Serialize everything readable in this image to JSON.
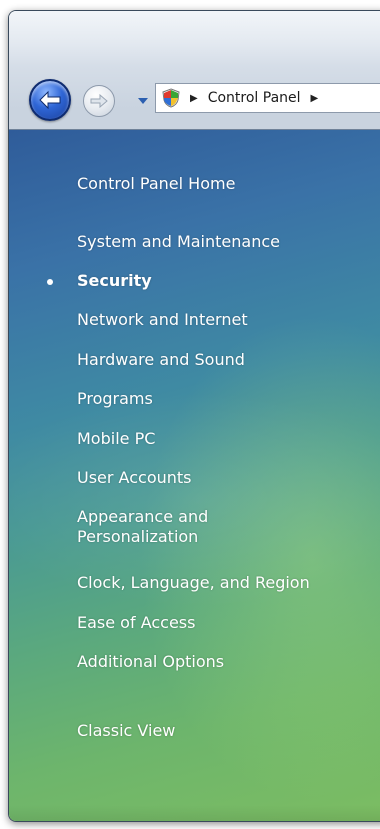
{
  "window": {
    "nav": {
      "back_icon": "back-arrow-icon",
      "forward_icon": "forward-arrow-icon",
      "dropdown_icon": "chevron-down-icon"
    },
    "address": {
      "shield_icon": "control-panel-shield-icon",
      "breadcrumb": [
        "Control Panel"
      ],
      "separator": "▶"
    }
  },
  "sidebar": {
    "home_label": "Control Panel Home",
    "items": [
      {
        "label": "System and Maintenance",
        "active": false
      },
      {
        "label": "Security",
        "active": true
      },
      {
        "label": "Network and Internet",
        "active": false
      },
      {
        "label": "Hardware and Sound",
        "active": false
      },
      {
        "label": "Programs",
        "active": false
      },
      {
        "label": "Mobile PC",
        "active": false
      },
      {
        "label": "User Accounts",
        "active": false
      },
      {
        "label": "Appearance and Personalization",
        "active": false
      },
      {
        "label": "Clock, Language, and Region",
        "active": false
      },
      {
        "label": "Ease of Access",
        "active": false
      },
      {
        "label": "Additional Options",
        "active": false
      }
    ],
    "classic_view_label": "Classic View"
  },
  "colors": {
    "pane_top": "#2f5c9a",
    "pane_bottom": "#7cbd62",
    "link": "#ffffff"
  }
}
